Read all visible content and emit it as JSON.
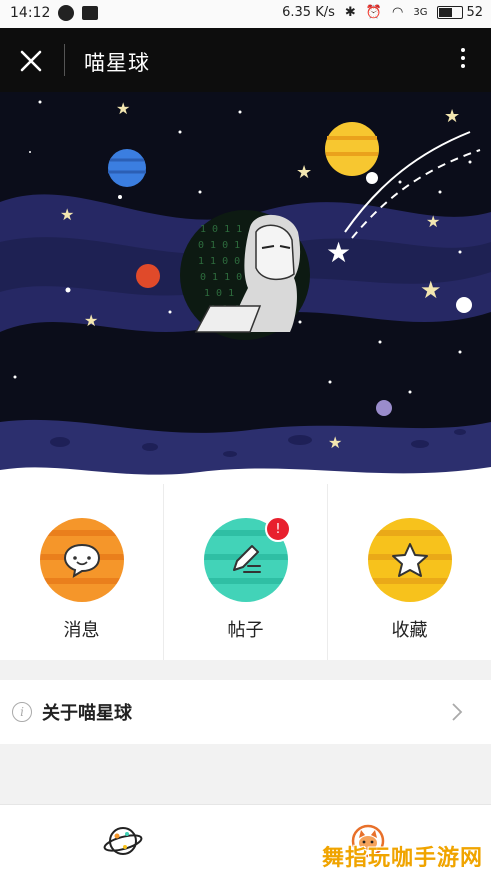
{
  "status_bar": {
    "time": "14:12",
    "net_speed": "6.35 K/s",
    "signal": "3G",
    "battery": "52",
    "battery_level": 0.52
  },
  "title_bar": {
    "title": "喵星球",
    "close_icon": "close-icon",
    "more_icon": "more-vertical-icon"
  },
  "actions": [
    {
      "label": "消息",
      "icon": "chat-bubble-icon",
      "color": "#f5962a"
    },
    {
      "label": "帖子",
      "icon": "pencil-icon",
      "color": "#3fd0b4",
      "badge": "!"
    },
    {
      "label": "收藏",
      "icon": "star-icon",
      "color": "#f7c21c"
    }
  ],
  "about": {
    "label": "关于喵星球",
    "icon": "info-icon"
  },
  "bottom_nav": [
    {
      "name": "planet-tab",
      "icon": "planet-icon"
    },
    {
      "name": "profile-tab",
      "icon": "cat-avatar-icon"
    }
  ],
  "watermark": "舞指玩咖手游网",
  "colors": {
    "night_sky": "#0b0d1a",
    "wave": "#2a2c6a",
    "accent_red": "#e8202e"
  }
}
